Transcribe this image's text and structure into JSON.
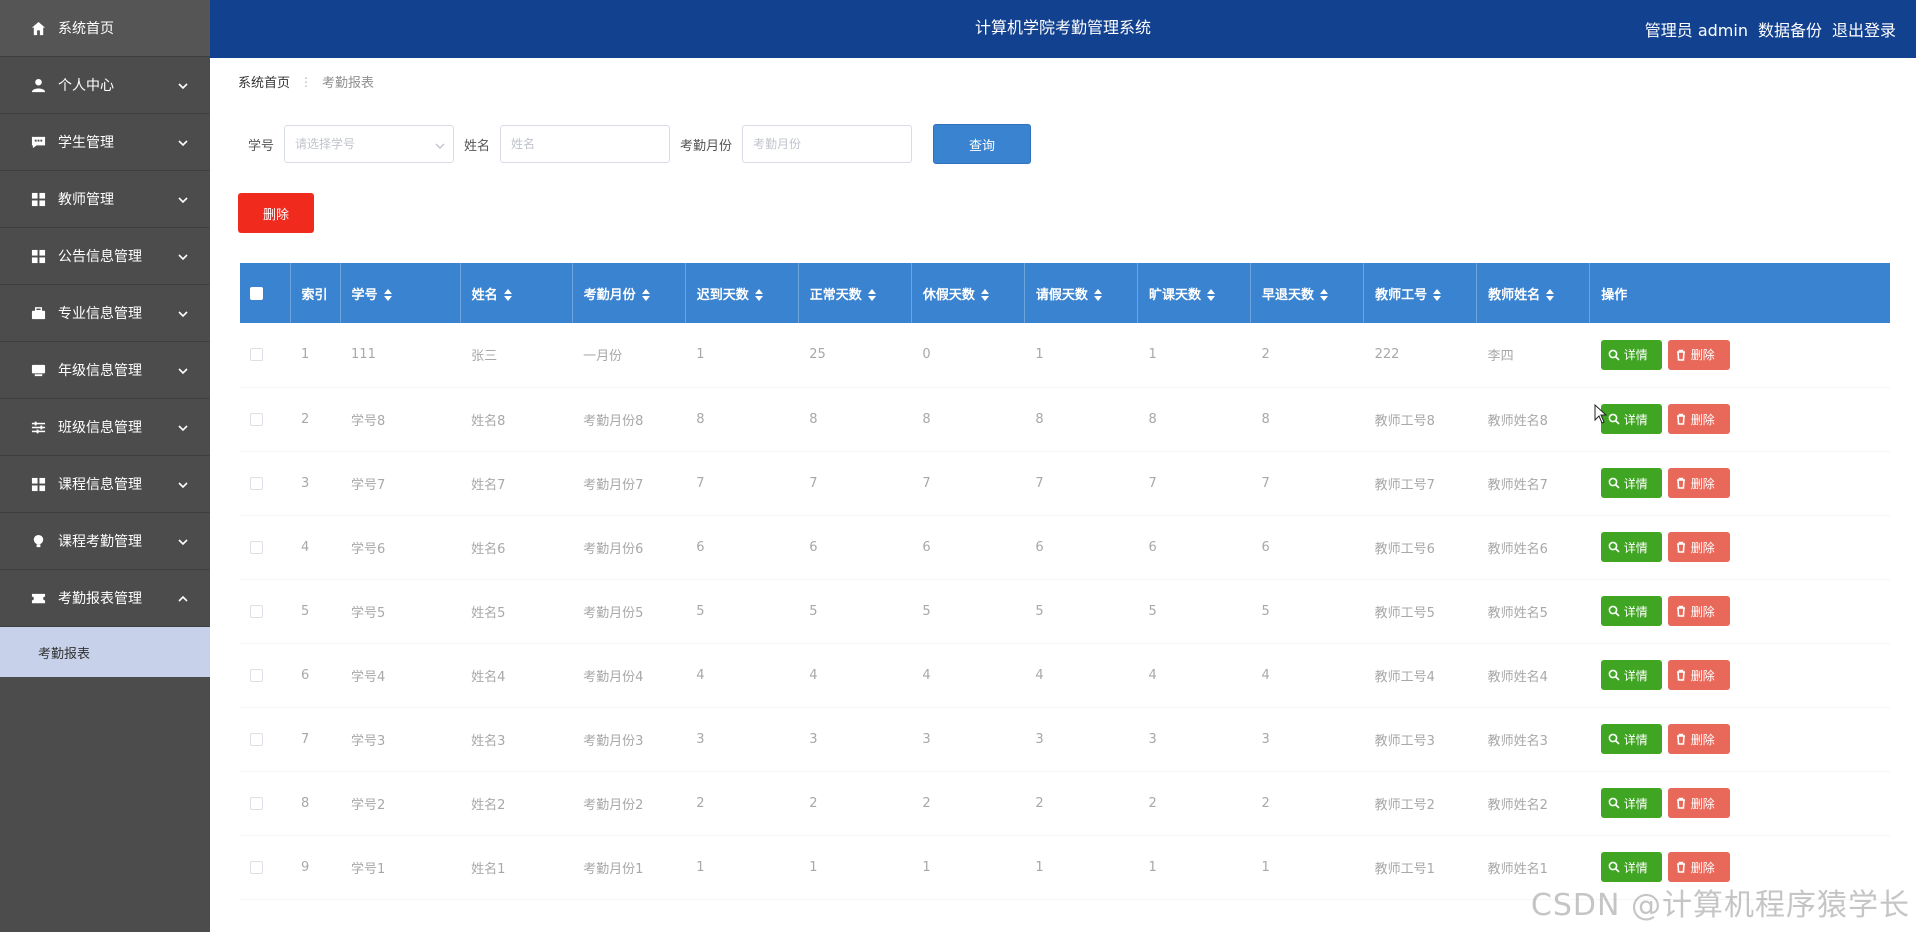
{
  "header": {
    "title": "计算机学院考勤管理系统",
    "user": "管理员 admin",
    "backup": "数据备份",
    "logout": "退出登录"
  },
  "sidebar": {
    "items": [
      {
        "label": "系统首页",
        "icon": "home-icon",
        "expandable": false
      },
      {
        "label": "个人中心",
        "icon": "user-icon",
        "expandable": true
      },
      {
        "label": "学生管理",
        "icon": "chat-icon",
        "expandable": true
      },
      {
        "label": "教师管理",
        "icon": "grid-icon",
        "expandable": true
      },
      {
        "label": "公告信息管理",
        "icon": "grid-icon",
        "expandable": true
      },
      {
        "label": "专业信息管理",
        "icon": "briefcase-icon",
        "expandable": true
      },
      {
        "label": "年级信息管理",
        "icon": "monitor-icon",
        "expandable": true
      },
      {
        "label": "班级信息管理",
        "icon": "sliders-icon",
        "expandable": true
      },
      {
        "label": "课程信息管理",
        "icon": "grid-icon",
        "expandable": true
      },
      {
        "label": "课程考勤管理",
        "icon": "bulb-icon",
        "expandable": true
      },
      {
        "label": "考勤报表管理",
        "icon": "ticket-icon",
        "expandable": true,
        "expanded": true
      }
    ],
    "sub_item": "考勤报表"
  },
  "breadcrumb": {
    "home": "系统首页",
    "separator": "⋮",
    "current": "考勤报表"
  },
  "search": {
    "student_id_label": "学号",
    "student_id_placeholder": "请选择学号",
    "name_label": "姓名",
    "name_placeholder": "姓名",
    "month_label": "考勤月份",
    "month_placeholder": "考勤月份",
    "query_button": "查询"
  },
  "batch_delete_button": "删除",
  "table": {
    "columns": [
      "索引",
      "学号",
      "姓名",
      "考勤月份",
      "迟到天数",
      "正常天数",
      "休假天数",
      "请假天数",
      "旷课天数",
      "早退天数",
      "教师工号",
      "教师姓名",
      "操作"
    ],
    "rows": [
      [
        "1",
        "111",
        "张三",
        "一月份",
        "1",
        "25",
        "0",
        "1",
        "1",
        "2",
        "222",
        "李四"
      ],
      [
        "2",
        "学号8",
        "姓名8",
        "考勤月份8",
        "8",
        "8",
        "8",
        "8",
        "8",
        "8",
        "教师工号8",
        "教师姓名8"
      ],
      [
        "3",
        "学号7",
        "姓名7",
        "考勤月份7",
        "7",
        "7",
        "7",
        "7",
        "7",
        "7",
        "教师工号7",
        "教师姓名7"
      ],
      [
        "4",
        "学号6",
        "姓名6",
        "考勤月份6",
        "6",
        "6",
        "6",
        "6",
        "6",
        "6",
        "教师工号6",
        "教师姓名6"
      ],
      [
        "5",
        "学号5",
        "姓名5",
        "考勤月份5",
        "5",
        "5",
        "5",
        "5",
        "5",
        "5",
        "教师工号5",
        "教师姓名5"
      ],
      [
        "6",
        "学号4",
        "姓名4",
        "考勤月份4",
        "4",
        "4",
        "4",
        "4",
        "4",
        "4",
        "教师工号4",
        "教师姓名4"
      ],
      [
        "7",
        "学号3",
        "姓名3",
        "考勤月份3",
        "3",
        "3",
        "3",
        "3",
        "3",
        "3",
        "教师工号3",
        "教师姓名3"
      ],
      [
        "8",
        "学号2",
        "姓名2",
        "考勤月份2",
        "2",
        "2",
        "2",
        "2",
        "2",
        "2",
        "教师工号2",
        "教师姓名2"
      ],
      [
        "9",
        "学号1",
        "姓名1",
        "考勤月份1",
        "1",
        "1",
        "1",
        "1",
        "1",
        "1",
        "教师工号1",
        "教师姓名1"
      ]
    ],
    "detail_button": "详情",
    "delete_button": "删除"
  },
  "watermark": "CSDN @计算机程序猿学长",
  "colors": {
    "header_bg": "#124190",
    "sidebar_bg": "#4c4c4c",
    "table_header_bg": "#3a83d0",
    "detail_button": "#3fa522",
    "delete_button": "#e8685a",
    "batch_delete": "#f02b1d"
  }
}
